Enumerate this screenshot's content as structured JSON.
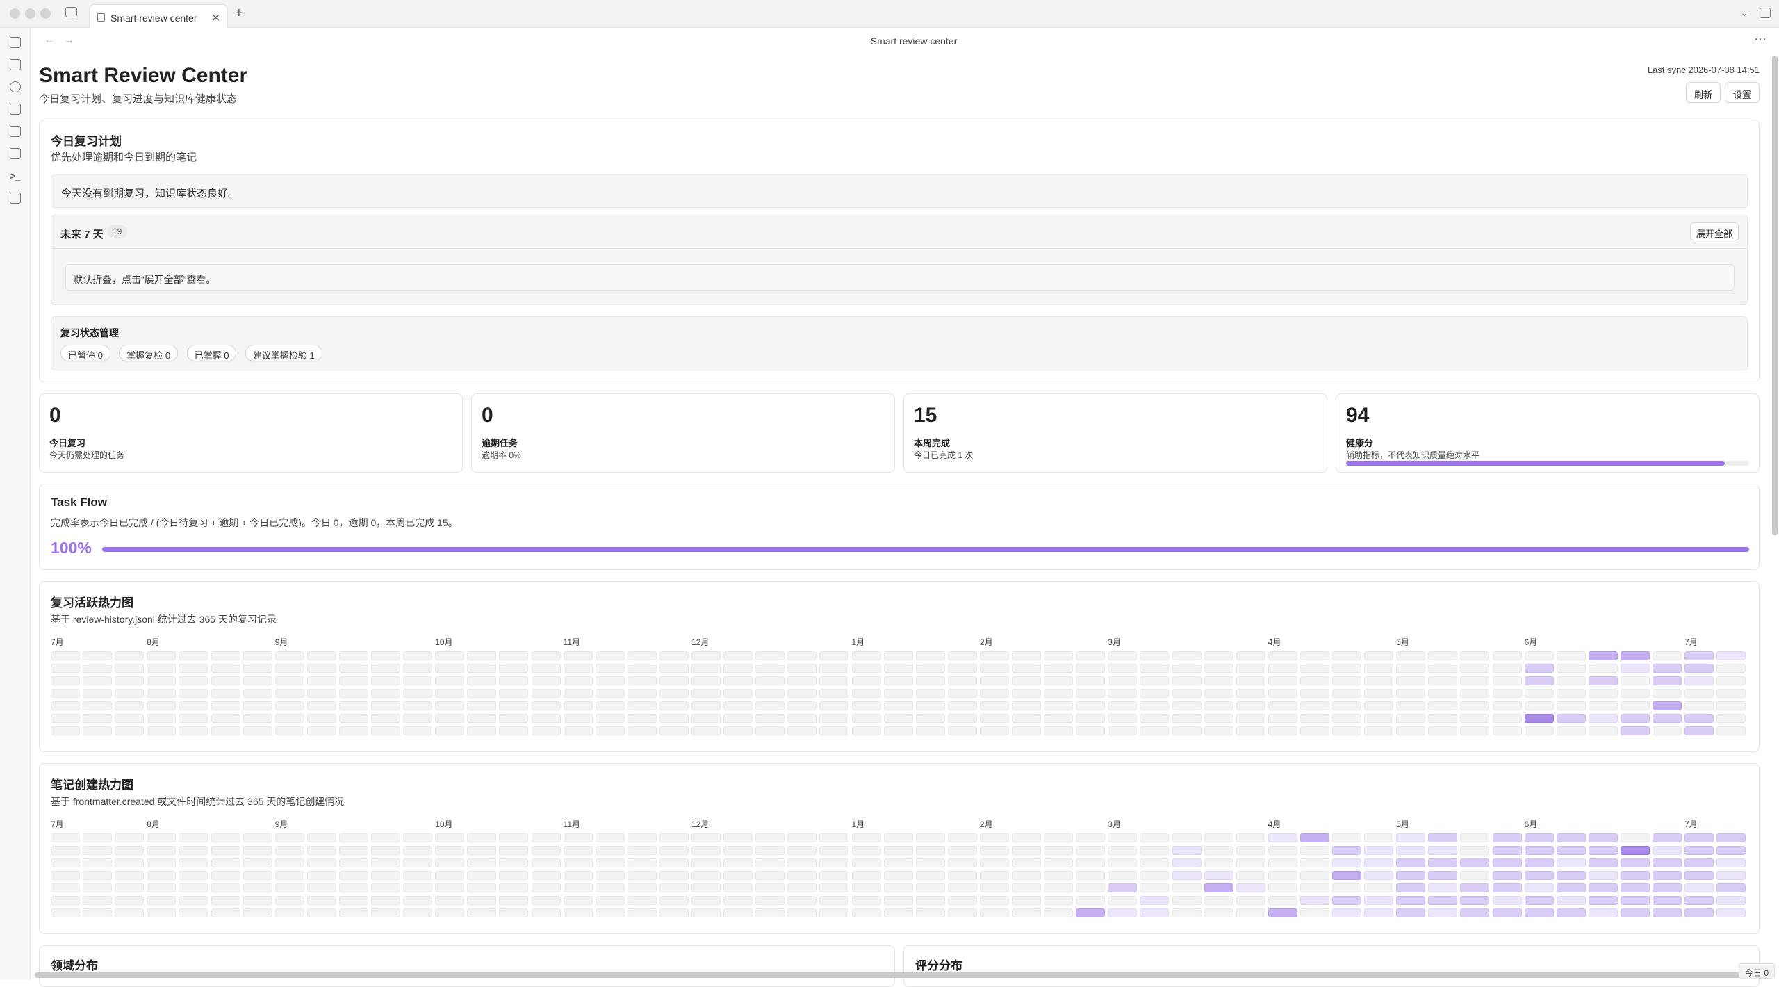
{
  "window": {
    "tab_title": "Smart review center",
    "view_title": "Smart review center"
  },
  "header": {
    "title": "Smart Review Center",
    "subtitle": "今日复习计划、复习进度与知识库健康状态",
    "last_sync": "Last sync 2026-07-08 14:51",
    "refresh_label": "刷新",
    "settings_label": "设置"
  },
  "plan": {
    "title": "今日复习计划",
    "subtitle": "优先处理逾期和今日到期的笔记",
    "empty_message": "今天没有到期复习，知识库状态良好。",
    "upcoming_title": "未来 7 天",
    "upcoming_count": "19",
    "expand_label": "展开全部",
    "collapsed_hint": "默认折叠，点击“展开全部”查看。",
    "status_title": "复习状态管理",
    "status_pills": [
      "已暂停 0",
      "掌握复检 0",
      "已掌握 0",
      "建议掌握检验 1"
    ]
  },
  "stats": [
    {
      "value": "0",
      "label": "今日复习",
      "desc": "今天仍需处理的任务"
    },
    {
      "value": "0",
      "label": "逾期任务",
      "desc": "逾期率 0%"
    },
    {
      "value": "15",
      "label": "本周完成",
      "desc": "今日已完成 1 次"
    },
    {
      "value": "94",
      "label": "健康分",
      "desc": "辅助指标，不代表知识质量绝对水平",
      "progress": 0.94
    }
  ],
  "task_flow": {
    "title": "Task Flow",
    "description": "完成率表示今日已完成 / (今日待复习 + 逾期 + 今日已完成)。今日 0，逾期 0，本周已完成 15。",
    "percent_label": "100%",
    "progress": 1.0
  },
  "review_heatmap": {
    "title": "复习活跃热力图",
    "subtitle": "基于 review-history.jsonl 统计过去 365 天的复习记录",
    "months": [
      {
        "label": "7月",
        "col": 0
      },
      {
        "label": "8月",
        "col": 3
      },
      {
        "label": "9月",
        "col": 7
      },
      {
        "label": "10月",
        "col": 12
      },
      {
        "label": "11月",
        "col": 16
      },
      {
        "label": "12月",
        "col": 20
      },
      {
        "label": "1月",
        "col": 25
      },
      {
        "label": "2月",
        "col": 29
      },
      {
        "label": "3月",
        "col": 33
      },
      {
        "label": "4月",
        "col": 38
      },
      {
        "label": "5月",
        "col": 42
      },
      {
        "label": "6月",
        "col": 46
      },
      {
        "label": "7月",
        "col": 51
      }
    ],
    "weeks": 53,
    "active": [
      [
        46,
        1,
        2
      ],
      [
        46,
        2,
        2
      ],
      [
        46,
        5,
        4
      ],
      [
        47,
        5,
        2
      ],
      [
        48,
        0,
        3
      ],
      [
        48,
        2,
        2
      ],
      [
        48,
        5,
        1
      ],
      [
        49,
        0,
        3
      ],
      [
        49,
        1,
        1
      ],
      [
        49,
        5,
        2
      ],
      [
        49,
        6,
        2
      ],
      [
        50,
        1,
        2
      ],
      [
        50,
        2,
        2
      ],
      [
        50,
        4,
        3
      ],
      [
        50,
        5,
        2
      ],
      [
        51,
        0,
        2
      ],
      [
        51,
        1,
        2
      ],
      [
        51,
        2,
        1
      ],
      [
        51,
        5,
        2
      ],
      [
        51,
        6,
        2
      ],
      [
        52,
        0,
        1
      ]
    ]
  },
  "creation_heatmap": {
    "title": "笔记创建热力图",
    "subtitle": "基于 frontmatter.created 或文件时间统计过去 365 天的笔记创建情况",
    "months": [
      {
        "label": "7月",
        "col": 0
      },
      {
        "label": "8月",
        "col": 3
      },
      {
        "label": "9月",
        "col": 7
      },
      {
        "label": "10月",
        "col": 12
      },
      {
        "label": "11月",
        "col": 16
      },
      {
        "label": "12月",
        "col": 20
      },
      {
        "label": "1月",
        "col": 25
      },
      {
        "label": "2月",
        "col": 29
      },
      {
        "label": "3月",
        "col": 33
      },
      {
        "label": "4月",
        "col": 38
      },
      {
        "label": "5月",
        "col": 42
      },
      {
        "label": "6月",
        "col": 46
      },
      {
        "label": "7月",
        "col": 51
      }
    ],
    "weeks": 53,
    "active": [
      [
        32,
        6,
        3
      ],
      [
        33,
        4,
        2
      ],
      [
        33,
        6,
        1
      ],
      [
        34,
        5,
        1
      ],
      [
        34,
        6,
        1
      ],
      [
        35,
        1,
        1
      ],
      [
        35,
        2,
        1
      ],
      [
        35,
        3,
        1
      ],
      [
        36,
        3,
        1
      ],
      [
        36,
        4,
        3
      ],
      [
        37,
        4,
        1
      ],
      [
        38,
        0,
        1
      ],
      [
        38,
        6,
        3
      ],
      [
        39,
        0,
        3
      ],
      [
        39,
        5,
        1
      ],
      [
        40,
        1,
        2
      ],
      [
        40,
        2,
        1
      ],
      [
        40,
        3,
        3
      ],
      [
        40,
        5,
        2
      ],
      [
        40,
        6,
        1
      ],
      [
        41,
        1,
        1
      ],
      [
        41,
        2,
        1
      ],
      [
        41,
        3,
        1
      ],
      [
        41,
        5,
        1
      ],
      [
        41,
        6,
        1
      ],
      [
        42,
        0,
        1
      ],
      [
        42,
        1,
        1
      ],
      [
        42,
        2,
        2
      ],
      [
        42,
        3,
        2
      ],
      [
        42,
        4,
        2
      ],
      [
        42,
        5,
        2
      ],
      [
        42,
        6,
        2
      ],
      [
        43,
        0,
        2
      ],
      [
        43,
        1,
        1
      ],
      [
        43,
        2,
        2
      ],
      [
        43,
        3,
        2
      ],
      [
        43,
        4,
        1
      ],
      [
        43,
        5,
        2
      ],
      [
        43,
        6,
        1
      ],
      [
        44,
        2,
        2
      ],
      [
        44,
        4,
        2
      ],
      [
        44,
        5,
        2
      ],
      [
        44,
        6,
        2
      ],
      [
        45,
        0,
        2
      ],
      [
        45,
        1,
        2
      ],
      [
        45,
        2,
        2
      ],
      [
        45,
        3,
        2
      ],
      [
        45,
        4,
        2
      ],
      [
        45,
        5,
        1
      ],
      [
        45,
        6,
        2
      ],
      [
        46,
        0,
        2
      ],
      [
        46,
        1,
        2
      ],
      [
        46,
        2,
        2
      ],
      [
        46,
        3,
        2
      ],
      [
        46,
        4,
        1
      ],
      [
        46,
        5,
        2
      ],
      [
        46,
        6,
        2
      ],
      [
        47,
        0,
        2
      ],
      [
        47,
        1,
        2
      ],
      [
        47,
        2,
        1
      ],
      [
        47,
        3,
        2
      ],
      [
        47,
        4,
        2
      ],
      [
        47,
        5,
        1
      ],
      [
        47,
        6,
        2
      ],
      [
        48,
        0,
        2
      ],
      [
        48,
        1,
        2
      ],
      [
        48,
        2,
        2
      ],
      [
        48,
        3,
        1
      ],
      [
        48,
        4,
        2
      ],
      [
        48,
        5,
        2
      ],
      [
        48,
        6,
        1
      ],
      [
        49,
        1,
        4
      ],
      [
        49,
        2,
        2
      ],
      [
        49,
        3,
        2
      ],
      [
        49,
        4,
        2
      ],
      [
        49,
        5,
        2
      ],
      [
        49,
        6,
        2
      ],
      [
        50,
        0,
        2
      ],
      [
        50,
        1,
        1
      ],
      [
        50,
        2,
        2
      ],
      [
        50,
        3,
        2
      ],
      [
        50,
        4,
        2
      ],
      [
        50,
        5,
        2
      ],
      [
        50,
        6,
        2
      ],
      [
        51,
        0,
        2
      ],
      [
        51,
        1,
        2
      ],
      [
        51,
        2,
        2
      ],
      [
        51,
        3,
        2
      ],
      [
        51,
        4,
        1
      ],
      [
        51,
        5,
        2
      ],
      [
        51,
        6,
        2
      ],
      [
        52,
        0,
        2
      ],
      [
        52,
        1,
        2
      ],
      [
        52,
        2,
        1
      ],
      [
        52,
        3,
        1
      ],
      [
        52,
        4,
        2
      ],
      [
        52,
        5,
        1
      ],
      [
        52,
        6,
        1
      ]
    ]
  },
  "bottom_cards": {
    "domain_title": "领域分布",
    "rating_title": "评分分布"
  },
  "status_bar": {
    "text": "今日 0"
  },
  "colors": {
    "accent": "#9b72e8"
  }
}
